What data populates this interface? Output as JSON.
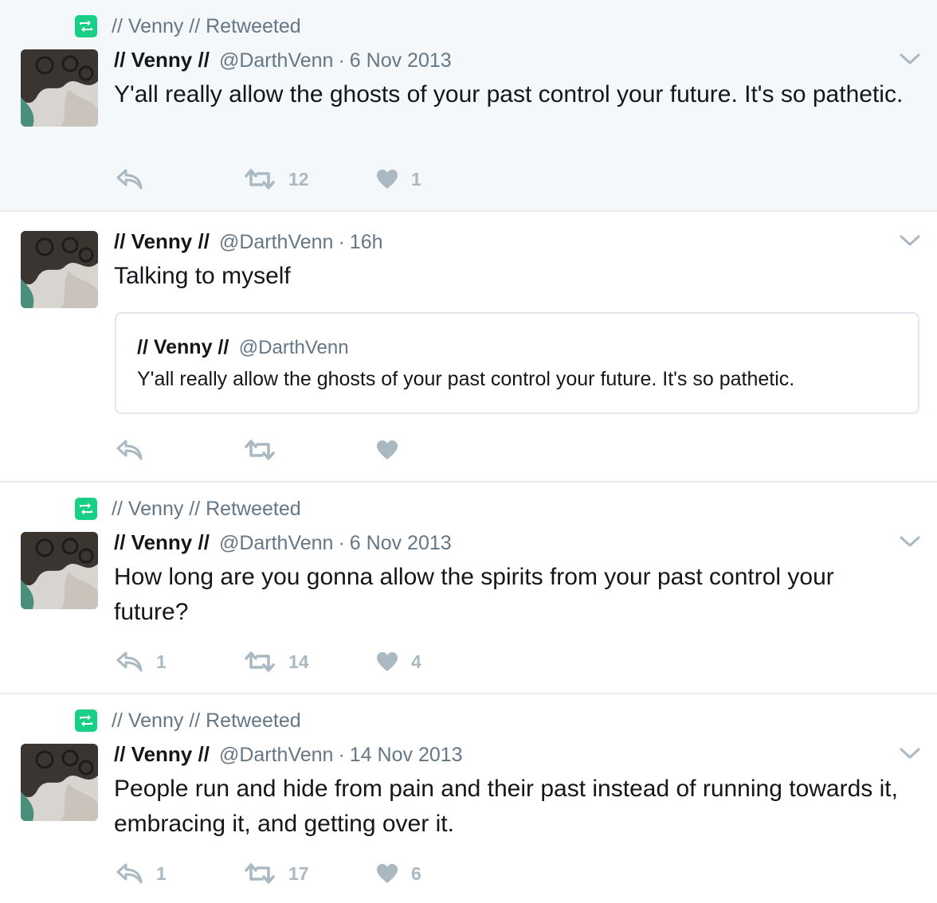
{
  "tweets": [
    {
      "retweeted_by": "// Venny // Retweeted",
      "name": "// Venny //",
      "handle": "@DarthVenn",
      "sep": "·",
      "time": "6 Nov 2013",
      "text": "Y'all really allow the ghosts of your past control your future. It's so pathetic.",
      "reply_count": "",
      "retweet_count": "12",
      "like_count": "1"
    },
    {
      "retweeted_by": "",
      "name": "// Venny //",
      "handle": "@DarthVenn",
      "sep": "·",
      "time": "16h",
      "text": "Talking to myself",
      "quote": {
        "name": "// Venny //",
        "handle": "@DarthVenn",
        "text": "Y'all really allow the ghosts of your past control your future. It's so pathetic."
      },
      "reply_count": "",
      "retweet_count": "",
      "like_count": ""
    },
    {
      "retweeted_by": "// Venny // Retweeted",
      "name": "// Venny //",
      "handle": "@DarthVenn",
      "sep": "·",
      "time": "6 Nov 2013",
      "text": "How long are you gonna allow the spirits from your past control your future?",
      "reply_count": "1",
      "retweet_count": "14",
      "like_count": "4"
    },
    {
      "retweeted_by": "// Venny // Retweeted",
      "name": "// Venny //",
      "handle": "@DarthVenn",
      "sep": "·",
      "time": "14 Nov 2013",
      "text": "People run and hide from pain and their past instead of running towards it, embracing it, and getting over it.",
      "reply_count": "1",
      "retweet_count": "17",
      "like_count": "6"
    }
  ],
  "icons": {
    "retweet_badge": "retweet-icon",
    "reply": "reply-icon",
    "retweet": "retweet-icon",
    "like": "heart-icon",
    "caret": "chevron-down-icon"
  },
  "colors": {
    "retweet_green": "#19cf86",
    "action_gray": "#aab8c2",
    "secondary_text": "#657786",
    "highlight_bg": "#f5f8fa"
  }
}
